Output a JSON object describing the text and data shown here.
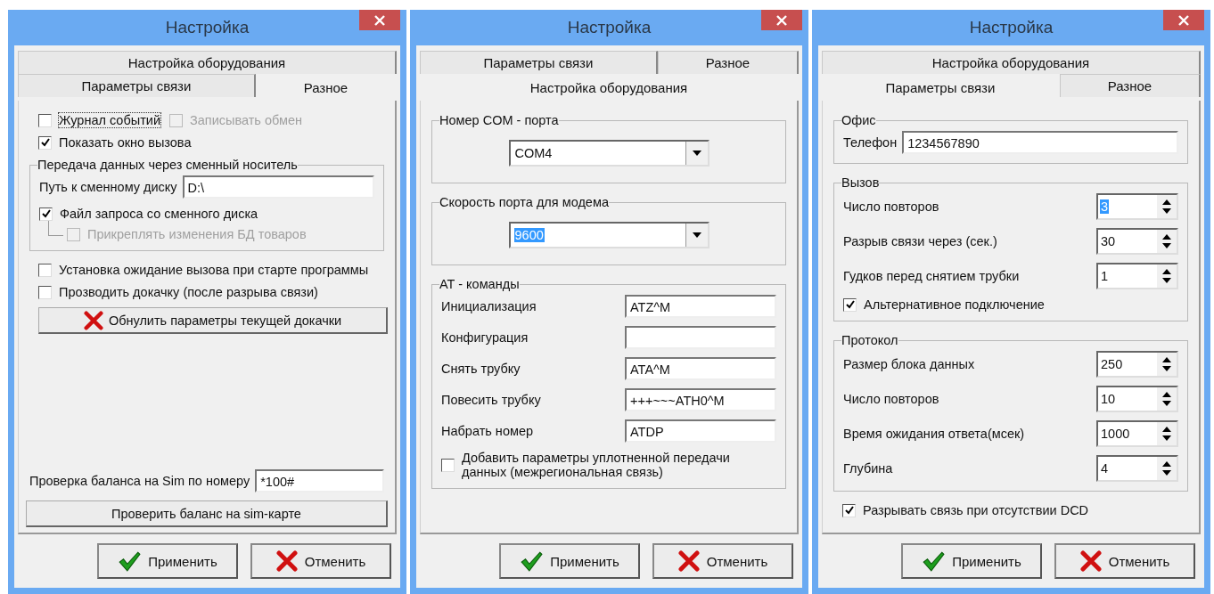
{
  "windows": [
    {
      "title": "Настройка",
      "tab_rows": [
        [
          {
            "label": "Настройка оборудования",
            "selected": false
          }
        ],
        [
          {
            "label": "Параметры связи",
            "selected": false
          },
          {
            "label": "Разное",
            "selected": true
          }
        ]
      ],
      "items": [
        {
          "kind": "row",
          "items": [
            {
              "kind": "checkbox",
              "label": "Журнал событий",
              "checked": false,
              "disabled": false,
              "focused": true
            },
            {
              "kind": "checkbox",
              "label": "Записывать обмен",
              "checked": false,
              "disabled": true,
              "focused": false
            }
          ]
        },
        {
          "kind": "checkbox",
          "label": "Показать окно вызова",
          "checked": true,
          "disabled": false,
          "focused": false
        },
        {
          "kind": "group",
          "title": "Передача данных через сменный носитель",
          "items": [
            {
              "kind": "field",
              "label": "Путь к сменному диску",
              "value": "D:\\"
            },
            {
              "kind": "checkbox",
              "label": "Файл запроса со сменного диска",
              "checked": true,
              "disabled": false,
              "focused": false,
              "children": [
                {
                  "kind": "checkbox",
                  "label": "Прикреплять изменения БД товаров",
                  "checked": false,
                  "disabled": true,
                  "focused": false
                }
              ]
            }
          ]
        },
        {
          "kind": "checkbox",
          "label": "Установка ожидание вызова при старте программы",
          "checked": false,
          "disabled": false,
          "focused": false
        },
        {
          "kind": "checkbox",
          "label": "Прозводить докачку (после разрыва связи)",
          "checked": false,
          "disabled": false,
          "focused": false
        },
        {
          "kind": "icon_button",
          "label": "Обнулить параметры текущей докачки"
        },
        {
          "kind": "spacer"
        },
        {
          "kind": "field",
          "label": "Проверка баланса на Sim по номеру",
          "value": "*100#"
        },
        {
          "kind": "button",
          "label": "Проверить баланс на sim-карте"
        }
      ],
      "footer": [
        {
          "label": "Применить"
        },
        {
          "label": "Отменить"
        }
      ]
    },
    {
      "title": "Настройка",
      "tab_rows": [
        [
          {
            "label": "Параметры связи",
            "selected": false
          },
          {
            "label": "Разное",
            "selected": false
          }
        ],
        [
          {
            "label": "Настройка оборудования",
            "selected": true
          }
        ]
      ],
      "items": [
        {
          "kind": "group",
          "title": "Номер COM - порта",
          "items": [
            {
              "kind": "combo",
              "value": "COM4",
              "highlighted": false
            }
          ]
        },
        {
          "kind": "group",
          "title": "Скорость порта для модема",
          "items": [
            {
              "kind": "combo",
              "value": "9600",
              "highlighted": true
            }
          ]
        },
        {
          "kind": "group",
          "title": "AT - команды",
          "items": [
            {
              "kind": "field",
              "label": "Инициализация",
              "value": "ATZ^M"
            },
            {
              "kind": "field",
              "label": "Конфигурация"
            },
            {
              "kind": "field",
              "label": "Снять трубку",
              "value": "ATA^M"
            },
            {
              "kind": "field",
              "label": "Повесить трубку",
              "value": "+++~~~ATH0^M"
            },
            {
              "kind": "field",
              "label": "Набрать номер",
              "value": "ATDP"
            },
            {
              "kind": "checkbox",
              "label": "Добавить параметры уплотненной передачи данных (межрегиональная связь)",
              "checked": false,
              "disabled": false,
              "focused": false
            }
          ]
        }
      ],
      "footer": [
        {
          "label": "Применить"
        },
        {
          "label": "Отменить"
        }
      ]
    },
    {
      "title": "Настройка",
      "tab_rows": [
        [
          {
            "label": "Настройка оборудования",
            "selected": false
          }
        ],
        [
          {
            "label": "Параметры связи",
            "selected": true
          },
          {
            "label": "Разное",
            "selected": false
          }
        ]
      ],
      "items": [
        {
          "kind": "group",
          "title": "Офис",
          "items": [
            {
              "kind": "field",
              "label": "Телефон",
              "value": "1234567890"
            }
          ]
        },
        {
          "kind": "group",
          "title": "Вызов",
          "items": [
            {
              "kind": "spin",
              "label": "Число повторов",
              "value": "3",
              "highlighted": true
            },
            {
              "kind": "spin",
              "label": "Разрыв связи через (сек.)",
              "value": "30",
              "highlighted": false
            },
            {
              "kind": "spin",
              "label": "Гудков перед снятием трубки",
              "value": "1",
              "highlighted": false
            },
            {
              "kind": "checkbox",
              "label": "Альтернативное подключение",
              "checked": true,
              "disabled": false,
              "focused": false
            }
          ]
        },
        {
          "kind": "group",
          "title": "Протокол",
          "items": [
            {
              "kind": "spin",
              "label": "Размер блока данных",
              "value": "250",
              "highlighted": false
            },
            {
              "kind": "spin",
              "label": "Число повторов",
              "value": "10",
              "highlighted": false
            },
            {
              "kind": "spin",
              "label": "Время ожидания ответа(мсек)",
              "value": "1000",
              "highlighted": false
            },
            {
              "kind": "spin",
              "label": "Глубина",
              "value": "4",
              "highlighted": false
            }
          ]
        },
        {
          "kind": "checkbox",
          "label": "Разрывать связь при отсутствии DCD",
          "checked": true,
          "disabled": false,
          "focused": false
        }
      ],
      "footer": [
        {
          "label": "Применить"
        },
        {
          "label": "Отменить"
        }
      ]
    }
  ]
}
